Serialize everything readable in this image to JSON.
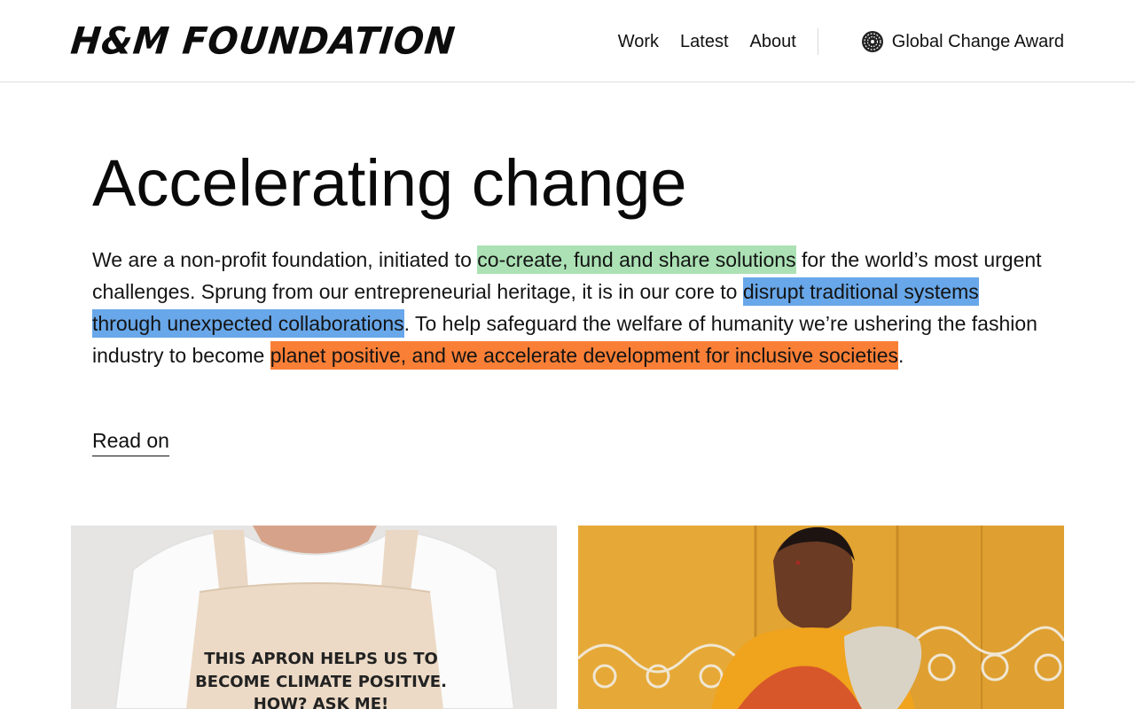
{
  "header": {
    "logo_text": "H&M FOUNDATION",
    "nav": [
      {
        "label": "Work"
      },
      {
        "label": "Latest"
      },
      {
        "label": "About"
      }
    ],
    "award_label": "Global Change Award"
  },
  "hero": {
    "title": "Accelerating change",
    "intro_1": "We are a non-profit foundation, initiated to ",
    "highlight_green": "co-create, fund and share solutions",
    "intro_2": " for the world’s most urgent challenges. Sprung from our entrepreneurial heritage, it is in our core to ",
    "highlight_blue": "disrupt traditional systems through unexpected collaborations",
    "intro_3": ". To help safeguard the welfare of humanity we’re ushering the fashion industry to become ",
    "highlight_orange": "planet positive, and we accelerate development for inclusive societies",
    "intro_4": ".",
    "read_on": "Read on"
  },
  "cards": {
    "left_apron_text_1": "THIS APRON HELPS US TO",
    "left_apron_text_2": "BECOME CLIMATE POSITIVE.",
    "left_apron_text_3": "HOW? ASK ME!"
  },
  "colors": {
    "highlight_green": "#abe1b4",
    "highlight_blue": "#68a7e9",
    "highlight_orange": "#fa7f36",
    "card_right_bg": "#e3a632"
  }
}
